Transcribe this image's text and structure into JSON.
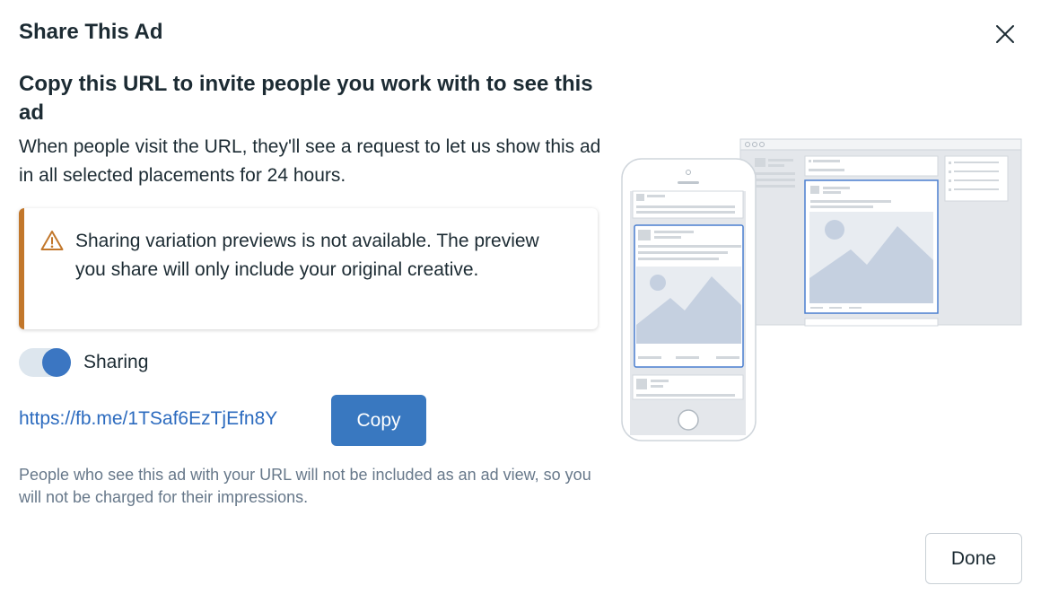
{
  "dialog": {
    "title": "Share This Ad",
    "heading": "Copy this URL to invite people you work with to see this ad",
    "description": "When people visit the URL, they'll see a request to let us show this ad in all selected placements for 24 hours."
  },
  "warning": {
    "icon": "warning-triangle-icon",
    "text": "Sharing variation previews is not available. The preview you share will only include your original creative.",
    "accent_color": "#c2772b"
  },
  "sharing_toggle": {
    "label": "Sharing",
    "on": true
  },
  "share_url": "https://fb.me/1TSaf6EzTjEfn8Y",
  "copy_button": {
    "label": "Copy"
  },
  "footnote": "People who see this ad with your URL will not be included as an ad view, so you will not be charged for their impressions.",
  "done_button": {
    "label": "Done"
  },
  "colors": {
    "primary": "#3978c0",
    "link": "#2c6bbf",
    "text": "#1c2b33",
    "muted_text": "#67788a"
  }
}
